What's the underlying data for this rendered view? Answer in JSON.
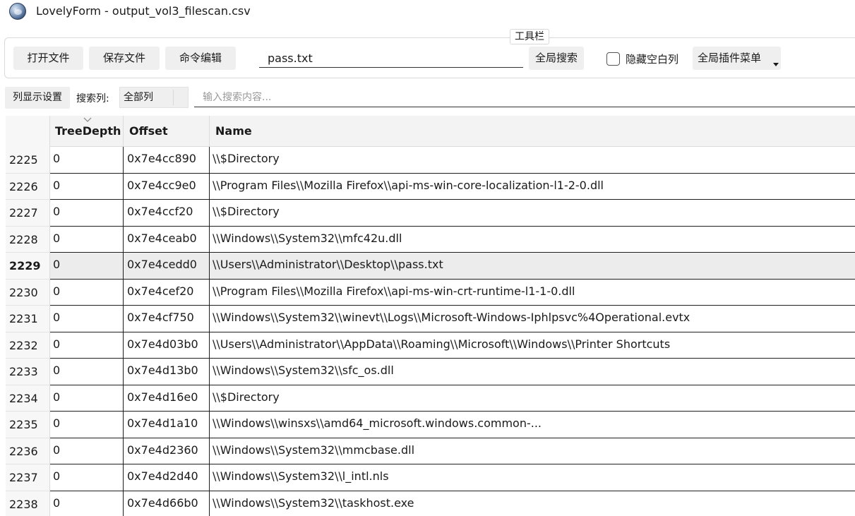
{
  "window": {
    "title": "LovelyForm - output_vol3_filescan.csv",
    "icon": "globe-app-icon"
  },
  "toolbar": {
    "legend": "工具栏",
    "open_label": "打开文件",
    "save_label": "保存文件",
    "cmd_label": "命令编辑",
    "search_value": "pass.txt",
    "global_search_label": "全局搜索",
    "hide_empty_label": "隐藏空白列",
    "hide_empty_checked": false,
    "plugin_menu_label": "全局插件菜单"
  },
  "filter": {
    "column_settings_label": "列显示设置",
    "search_column_label": "搜索列:",
    "search_column_value": "全部列",
    "search_placeholder": "输入搜索内容..."
  },
  "table": {
    "columns": [
      "TreeDepth",
      "Offset",
      "Name"
    ],
    "selected_row": "2229",
    "rows": [
      {
        "id": "2225",
        "depth": "0",
        "offset": "0x7e4cc890",
        "name": "\\\\$Directory"
      },
      {
        "id": "2226",
        "depth": "0",
        "offset": "0x7e4cc9e0",
        "name": "\\\\Program Files\\\\Mozilla Firefox\\\\api-ms-win-core-localization-l1-2-0.dll"
      },
      {
        "id": "2227",
        "depth": "0",
        "offset": "0x7e4ccf20",
        "name": "\\\\$Directory"
      },
      {
        "id": "2228",
        "depth": "0",
        "offset": "0x7e4ceab0",
        "name": "\\\\Windows\\\\System32\\\\mfc42u.dll"
      },
      {
        "id": "2229",
        "depth": "0",
        "offset": "0x7e4cedd0",
        "name": "\\\\Users\\\\Administrator\\\\Desktop\\\\pass.txt"
      },
      {
        "id": "2230",
        "depth": "0",
        "offset": "0x7e4cef20",
        "name": "\\\\Program Files\\\\Mozilla Firefox\\\\api-ms-win-crt-runtime-l1-1-0.dll"
      },
      {
        "id": "2231",
        "depth": "0",
        "offset": "0x7e4cf750",
        "name": "\\\\Windows\\\\System32\\\\winevt\\\\Logs\\\\Microsoft-Windows-Iphlpsvc%4Operational.evtx"
      },
      {
        "id": "2232",
        "depth": "0",
        "offset": "0x7e4d03b0",
        "name": "\\\\Users\\\\Administrator\\\\AppData\\\\Roaming\\\\Microsoft\\\\Windows\\\\Printer Shortcuts"
      },
      {
        "id": "2233",
        "depth": "0",
        "offset": "0x7e4d13b0",
        "name": "\\\\Windows\\\\System32\\\\sfc_os.dll"
      },
      {
        "id": "2234",
        "depth": "0",
        "offset": "0x7e4d16e0",
        "name": "\\\\$Directory"
      },
      {
        "id": "2235",
        "depth": "0",
        "offset": "0x7e4d1a10",
        "name": "\\\\Windows\\\\winsxs\\\\amd64_microsoft.windows.common-..."
      },
      {
        "id": "2236",
        "depth": "0",
        "offset": "0x7e4d2360",
        "name": "\\\\Windows\\\\System32\\\\mmcbase.dll"
      },
      {
        "id": "2237",
        "depth": "0",
        "offset": "0x7e4d2d40",
        "name": "\\\\Windows\\\\System32\\\\l_intl.nls"
      },
      {
        "id": "2238",
        "depth": "0",
        "offset": "0x7e4d66b0",
        "name": "\\\\Windows\\\\System32\\\\taskhost.exe"
      }
    ]
  },
  "colors": {
    "button_bg": "#efefef",
    "header_bg": "#f3f3f3",
    "selected_row_bg": "#ececec"
  }
}
